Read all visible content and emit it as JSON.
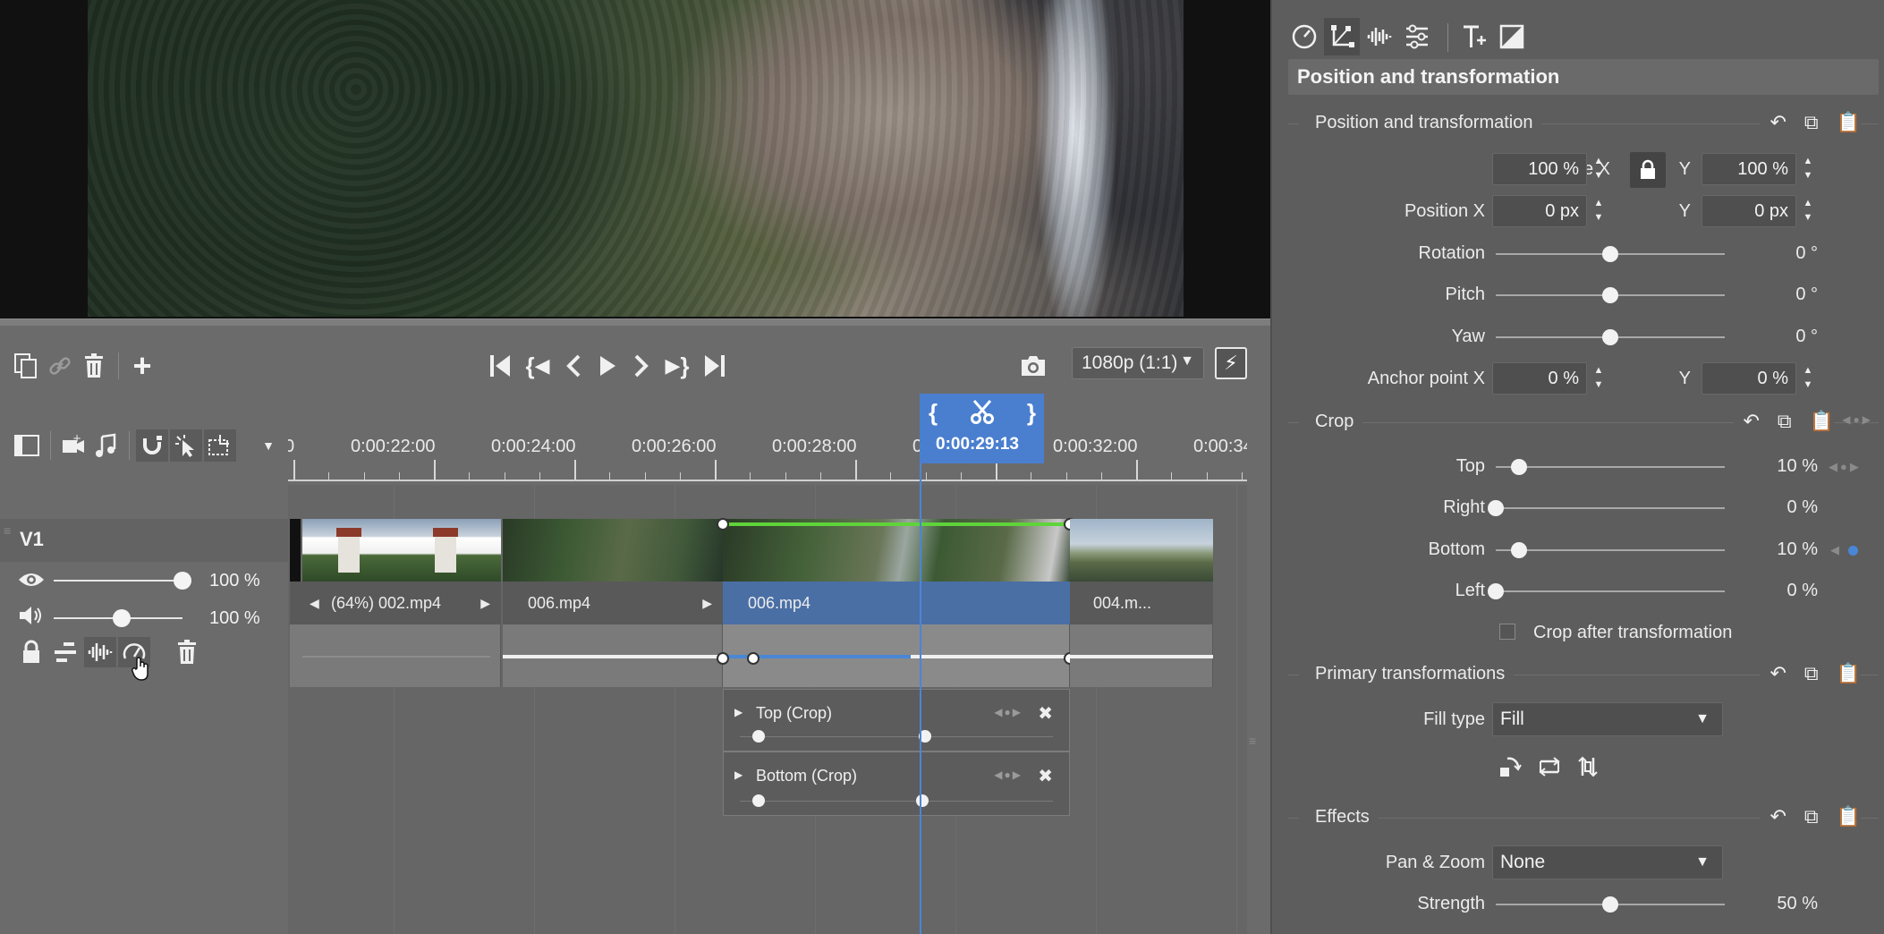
{
  "preview": {
    "scene": "waterfall-forest-frame"
  },
  "transport": {
    "resolution": "1080p (1:1)"
  },
  "ruler": {
    "labels": [
      "0",
      "0:00:22:00",
      "0:00:24:00",
      "0:00:26:00",
      "0:00:28:00",
      "0",
      "0:00:32:00",
      "0:00:34"
    ]
  },
  "playhead": {
    "time": "0:00:29:13"
  },
  "track": {
    "name": "V1",
    "visibility_value": "100 %",
    "volume_value": "100 %"
  },
  "clips": [
    {
      "label": "(64%) 002.mp4"
    },
    {
      "label": "006.mp4"
    },
    {
      "label": "006.mp4"
    },
    {
      "label": "004.m..."
    }
  ],
  "keyframe_tracks": [
    {
      "name": "Top (Crop)"
    },
    {
      "name": "Bottom (Crop)"
    }
  ],
  "panel": {
    "title": "Position and transformation",
    "position_section": {
      "title": "Position and transformation",
      "scale_x_label": "Scale X",
      "scale_x_value": "100 %",
      "scale_y_label": "Y",
      "scale_y_value": "100 %",
      "position_x_label": "Position X",
      "position_x_value": "0 px",
      "position_y_label": "Y",
      "position_y_value": "0 px",
      "rotation_label": "Rotation",
      "rotation_value": "0 °",
      "rotation_level": 0.5,
      "pitch_label": "Pitch",
      "pitch_value": "0 °",
      "pitch_level": 0.5,
      "yaw_label": "Yaw",
      "yaw_value": "0 °",
      "yaw_level": 0.5,
      "anchor_x_label": "Anchor point X",
      "anchor_x_value": "0 %",
      "anchor_y_label": "Y",
      "anchor_y_value": "0 %"
    },
    "crop_section": {
      "title": "Crop",
      "top_label": "Top",
      "top_value": "10 %",
      "top_level": 0.1,
      "right_label": "Right",
      "right_value": "0 %",
      "right_level": 0.0,
      "bottom_label": "Bottom",
      "bottom_value": "10 %",
      "bottom_level": 0.1,
      "left_label": "Left",
      "left_value": "0 %",
      "left_level": 0.0,
      "crop_after_label": "Crop after transformation"
    },
    "primary_section": {
      "title": "Primary transformations",
      "fill_type_label": "Fill type",
      "fill_type_value": "Fill"
    },
    "effects_section": {
      "title": "Effects",
      "pan_zoom_label": "Pan & Zoom",
      "pan_zoom_value": "None",
      "strength_label": "Strength",
      "strength_value": "50 %",
      "strength_level": 0.5
    }
  },
  "colors": {
    "accent": "#4a86d6",
    "keyframe_line": "#5fd43a",
    "selected_clip": "#4a6fa5"
  }
}
